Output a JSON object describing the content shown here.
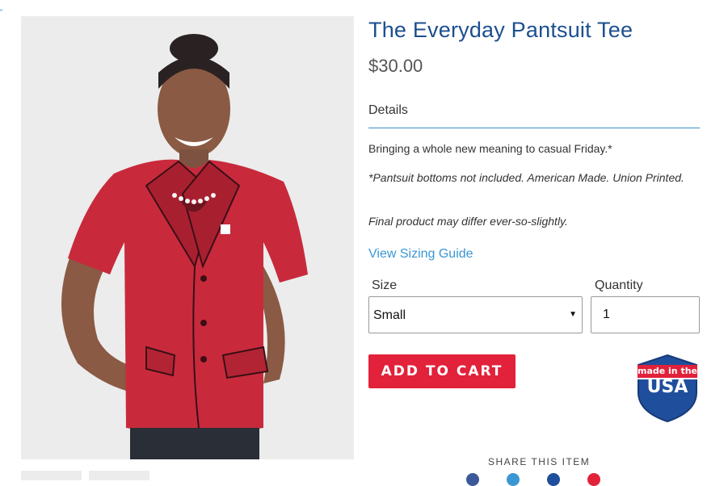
{
  "product": {
    "title": "The Everyday Pantsuit Tee",
    "price": "$30.00",
    "image_alt": "Woman wearing red pantsuit-print t-shirt"
  },
  "details": {
    "tab_label": "Details",
    "description": "Bringing a whole new meaning to casual Friday.*",
    "note": "*Pantsuit bottoms not included. American Made. Union Printed.",
    "disclaimer": "Final product may differ ever-so-slightly."
  },
  "sizing_link": "View Sizing Guide",
  "form": {
    "size_label": "Size",
    "size_value": "Small",
    "quantity_label": "Quantity",
    "quantity_value": "1"
  },
  "add_to_cart": "ADD TO CART",
  "badge": {
    "top_text": "made in the",
    "main_text": "USA"
  },
  "share": {
    "label": "SHARE THIS ITEM"
  },
  "colors": {
    "title": "#1c4f8f",
    "accent_link": "#3a97d2",
    "cart_button": "#e2213a",
    "badge_blue": "#1f4f9c",
    "shirt_red": "#c82a3c"
  },
  "icons": [
    "dropdown-arrow-icon",
    "share-icons"
  ]
}
